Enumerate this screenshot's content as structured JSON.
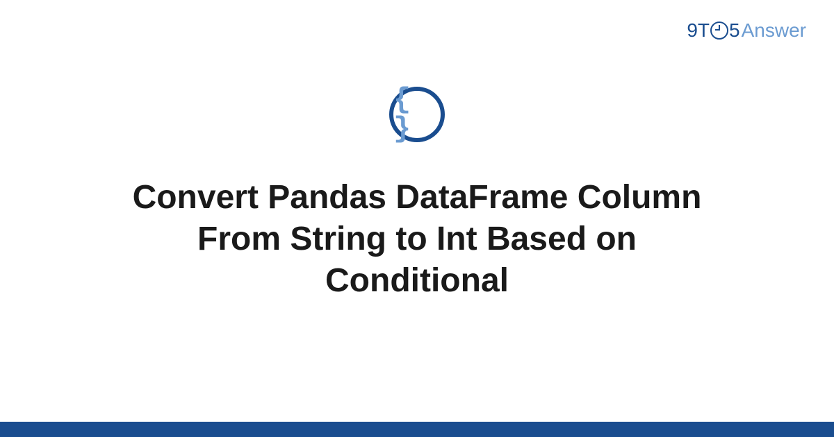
{
  "logo": {
    "part1": "9T",
    "part2": "5",
    "part3": "Answer"
  },
  "icon": {
    "braces": "{ }"
  },
  "title": "Convert Pandas DataFrame Column From String to Int Based on Conditional",
  "colors": {
    "primary": "#1a4d8f",
    "secondary": "#6b9bd1"
  }
}
